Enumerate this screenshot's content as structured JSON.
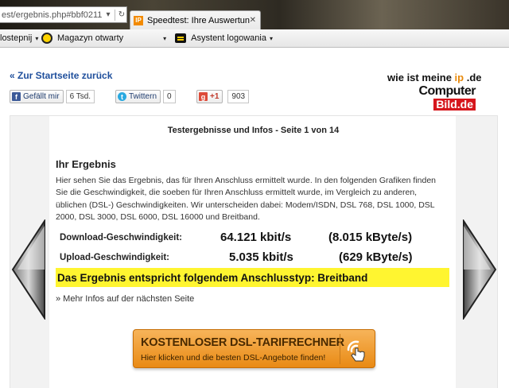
{
  "browser": {
    "url_fragment": "est/ergebnis.php#bbf0211",
    "tab_title": "Speedtest: Ihre Auswertung",
    "tab_favicon_text": "IP",
    "close_glyph": "✕",
    "toolbar": {
      "item1_label": "lostepnij",
      "item2_label": "Magazyn otwarty",
      "item3_label": "Asystent logowania",
      "arrow_glyph": "▾"
    }
  },
  "page": {
    "back_link": "« Zur Startseite zurück",
    "logo": {
      "line1_pre": "wie ist meine ",
      "line1_ip": "ip",
      "line1_post": " .de",
      "computer": "Computer",
      "bild": "Bild",
      "de": ".de"
    },
    "social": {
      "facebook_label": "Gefällt mir",
      "facebook_count": "6 Tsd.",
      "twitter_label": "Twittern",
      "twitter_count": "0",
      "gplus_label": "+1",
      "gplus_count": "903"
    },
    "panel_title": "Testergebnisse und Infos - Seite 1 von 14",
    "result_heading": "Ihr Ergebnis",
    "result_text": "Hier sehen Sie das Ergebnis, das für Ihren Anschluss ermittelt wurde. In den folgenden Grafiken finden Sie die Geschwindigkeit, die soeben für Ihren Anschluss ermittelt wurde, im Vergleich zu anderen, üblichen (DSL-) Geschwindigkeiten. Wir unterscheiden dabei: Modem/ISDN, DSL 768, DSL 1000, DSL 2000, DSL 3000, DSL 6000, DSL 16000 und Breitband.",
    "download": {
      "label": "Download-Geschwindigkeit:",
      "kbit": "64.121 kbit/s",
      "kbyte": "(8.015 kByte/s)"
    },
    "upload": {
      "label": "Upload-Geschwindigkeit:",
      "kbit": "5.035 kbit/s",
      "kbyte": "(629 kByte/s)"
    },
    "connection_type": "Das Ergebnis entspricht folgendem Anschlusstyp: Breitband",
    "more_link": "» Mehr Infos auf der nächsten Seite",
    "cta": {
      "title": "KOSTENLOSER DSL-TARIFRECHNER",
      "subtitle": "Hier klicken und die besten DSL-Angebote finden!"
    }
  },
  "colors": {
    "link_blue": "#1f4f9c",
    "highlight_yellow": "#fff530",
    "cta_orange": "#e98a14",
    "brand_red": "#d6161c"
  }
}
